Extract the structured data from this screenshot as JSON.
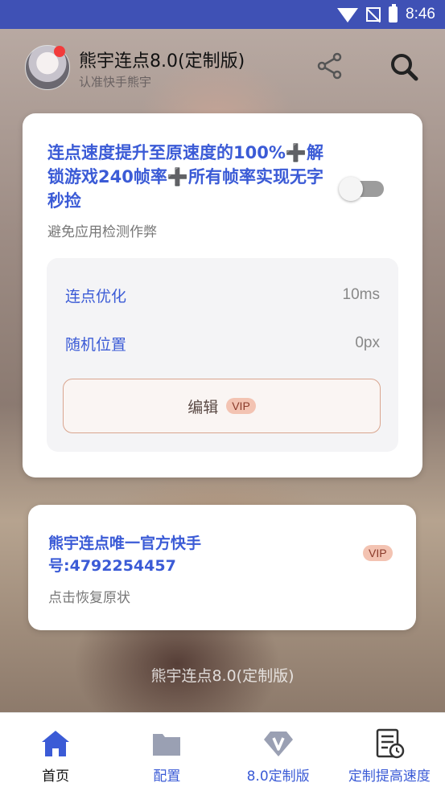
{
  "status_bar": {
    "time": "8:46",
    "icons": [
      "wifi-icon",
      "no-signal-icon",
      "battery-icon"
    ]
  },
  "header": {
    "title": "熊宇连点8.0(定制版)",
    "subtitle": "认准快手熊宇",
    "icons": [
      "share-icon",
      "search-icon"
    ]
  },
  "card1": {
    "title": "连点速度提升至原速度的100%➕解锁游戏240帧率➕所有帧率实现无字秒捡",
    "subtitle": "避免应用检测作弊",
    "toggle_on": false,
    "rows": [
      {
        "label": "连点优化",
        "value": "10ms"
      },
      {
        "label": "随机位置",
        "value": "0px"
      }
    ],
    "edit_label": "编辑",
    "vip": "VIP"
  },
  "card2": {
    "title": "熊宇连点唯一官方快手号:4792254457",
    "subtitle": "点击恢复原状",
    "vip": "VIP"
  },
  "footer": {
    "text": "熊宇连点8.0(定制版)"
  },
  "nav": {
    "items": [
      {
        "label": "首页",
        "icon": "home-icon",
        "active": true
      },
      {
        "label": "配置",
        "icon": "folder-icon",
        "active": false
      },
      {
        "label": "8.0定制版",
        "icon": "diamond-v-icon",
        "active": false
      },
      {
        "label": "定制提高速度",
        "icon": "document-clock-icon",
        "active": false
      }
    ]
  },
  "colors": {
    "status_bar": "#3f51b5",
    "accent": "#3b5bd6",
    "vip_bg": "#f3c3b2",
    "toggle_off": "#9c9c9c"
  }
}
